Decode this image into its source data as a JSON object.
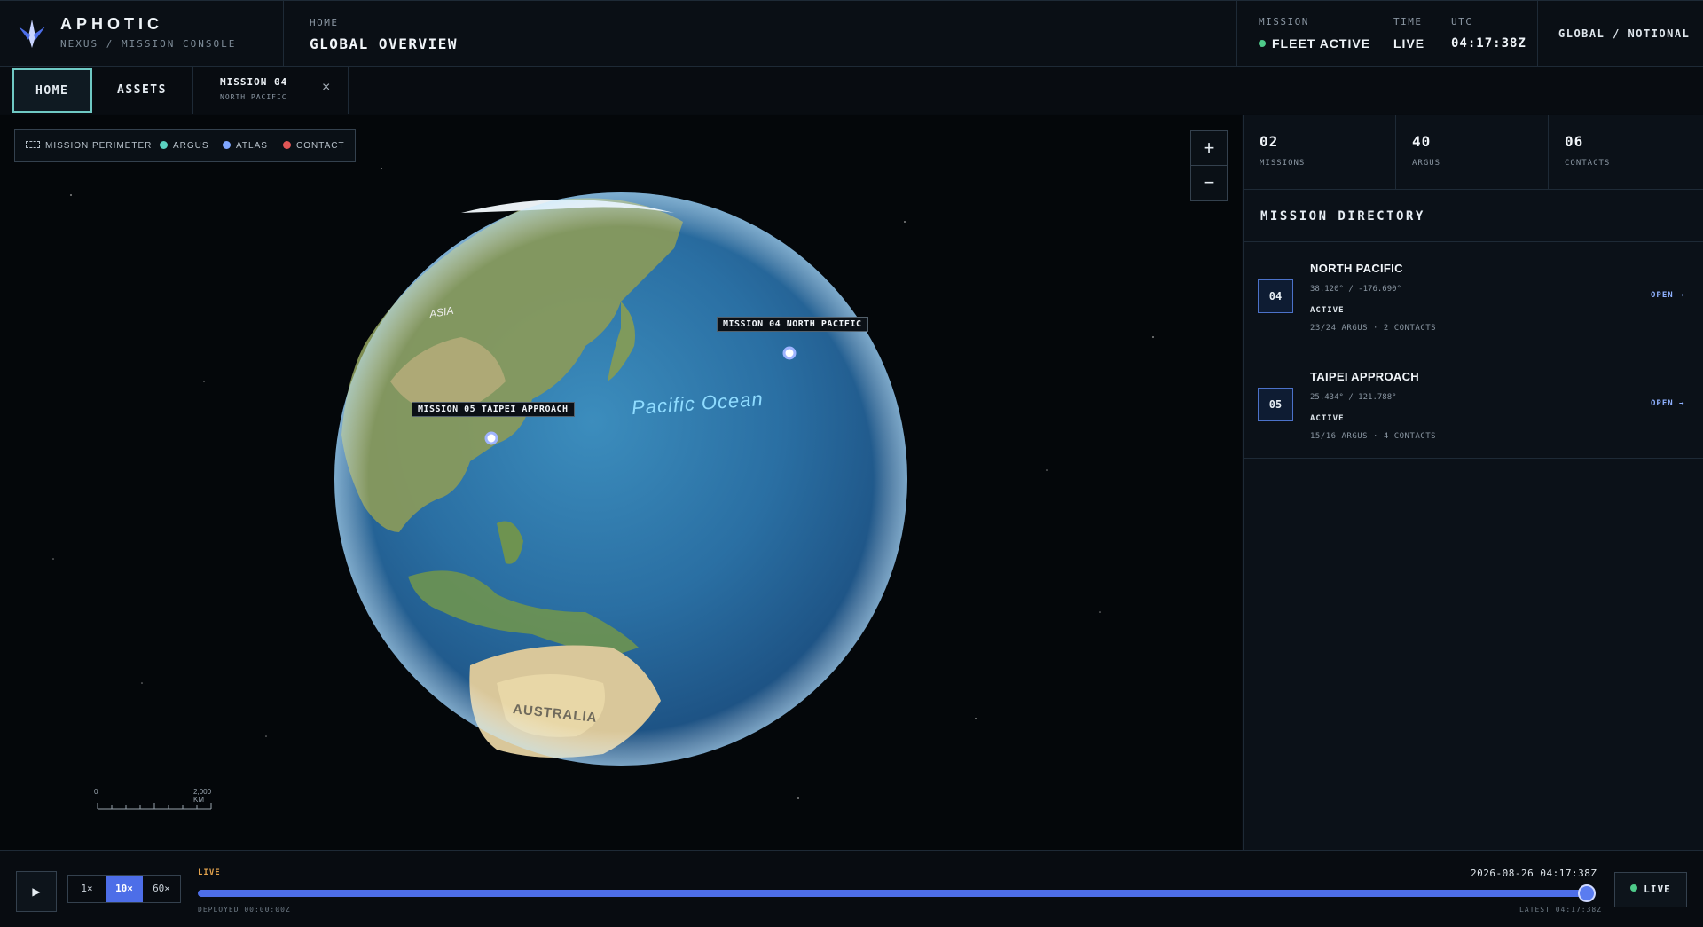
{
  "brand": {
    "name": "APHOTIC",
    "subtitle": "NEXUS / MISSION CONSOLE",
    "logo_icon": "aphotic-logo"
  },
  "header": {
    "breadcrumb": "HOME",
    "title": "GLOBAL OVERVIEW",
    "status": {
      "mission_label": "MISSION",
      "mission_value": "FLEET ACTIVE",
      "time_label": "TIME",
      "time_value": "LIVE",
      "utc_label": "UTC",
      "utc_value": "04:17:38Z"
    },
    "region": "GLOBAL / NOTIONAL"
  },
  "tabs": {
    "home": "HOME",
    "assets": "ASSETS",
    "mission_title": "MISSION 04",
    "mission_sub": "NORTH PACIFIC",
    "close_icon": "close-icon"
  },
  "map": {
    "legend": {
      "perimeter": "MISSION PERIMETER",
      "argus": "ARGUS",
      "atlas": "ATLAS",
      "contact": "CONTACT"
    },
    "legend_colors": {
      "argus": "#5ad1c0",
      "atlas": "#7fa6ff",
      "contact": "#e05555"
    },
    "zoom_in": "+",
    "zoom_out": "−",
    "callouts": {
      "mission04": "MISSION 04  NORTH PACIFIC",
      "mission05": "MISSION 05  TAIPEI APPROACH"
    },
    "labels": {
      "ocean": "Pacific Ocean",
      "australia": "AUSTRALIA",
      "asia": "ASIA"
    },
    "scale": {
      "start": "0",
      "end": "2,000 KM"
    }
  },
  "stats": [
    {
      "value": "02",
      "label": "MISSIONS"
    },
    {
      "value": "40",
      "label": "ARGUS"
    },
    {
      "value": "06",
      "label": "CONTACTS"
    }
  ],
  "directory": {
    "title": "MISSION DIRECTORY",
    "missions": [
      {
        "id": "04",
        "name": "NORTH PACIFIC",
        "coords": "38.120° / -176.690°",
        "state": "ACTIVE",
        "meta": "23/24 ARGUS · 2 CONTACTS",
        "open": "OPEN →"
      },
      {
        "id": "05",
        "name": "TAIPEI APPROACH",
        "coords": "25.434° / 121.788°",
        "state": "ACTIVE",
        "meta": "15/16 ARGUS · 4 CONTACTS",
        "open": "OPEN →"
      }
    ]
  },
  "timeline": {
    "play_icon": "▶",
    "speeds": [
      "1×",
      "10×",
      "60×"
    ],
    "active_speed": "10×",
    "live_tag": "LIVE",
    "datetime": "2026-08-26 04:17:38Z",
    "deployed": "DEPLOYED 00:00:00Z",
    "latest": "LATEST 04:17:38Z",
    "progress": 1.0,
    "live_button": "LIVE"
  },
  "colors": {
    "accent": "#4d6ee8",
    "live_green": "#4ecb8a",
    "tab_active_border": "#6fc9c4",
    "live_tag": "#e3a34d"
  }
}
